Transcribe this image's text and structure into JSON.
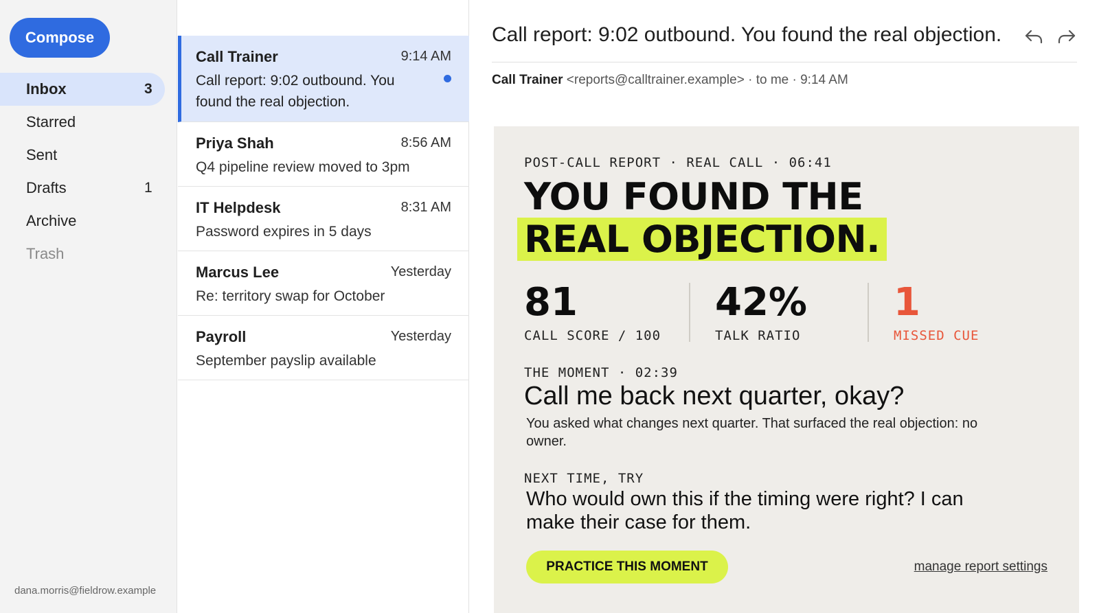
{
  "sidebar": {
    "compose_label": "Compose",
    "items": [
      {
        "label": "Inbox",
        "count": "3"
      },
      {
        "label": "Starred",
        "count": ""
      },
      {
        "label": "Sent",
        "count": ""
      },
      {
        "label": "Drafts",
        "count": "1"
      },
      {
        "label": "Archive",
        "count": ""
      },
      {
        "label": "Trash",
        "count": ""
      }
    ],
    "account": "dana.morris@fieldrow.example"
  },
  "messages": [
    {
      "sender": "Call Trainer",
      "time": "9:14 AM",
      "subject": "Call report: 9:02 outbound. You found the real objection.",
      "unread": true,
      "selected": true
    },
    {
      "sender": "Priya Shah",
      "time": "8:56 AM",
      "subject": "Q4 pipeline review moved to 3pm"
    },
    {
      "sender": "IT Helpdesk",
      "time": "8:31 AM",
      "subject": "Password expires in 5 days"
    },
    {
      "sender": "Marcus Lee",
      "time": "Yesterday",
      "subject": "Re: territory swap for October"
    },
    {
      "sender": "Payroll",
      "time": "Yesterday",
      "subject": "September payslip available"
    }
  ],
  "reader": {
    "subject": "Call report: 9:02 outbound. You found the real objection.",
    "from_name": "Call Trainer",
    "from_detail": "<reports@calltrainer.example> · to me · 9:14 AM",
    "icons": {
      "reply": "reply-icon",
      "forward": "forward-icon"
    }
  },
  "report": {
    "eyebrow": "POST-CALL REPORT · REAL CALL · 06:41",
    "headline_line1": "YOU FOUND THE",
    "headline_line2": "REAL OBJECTION.",
    "stats": [
      {
        "value": "81",
        "label": "CALL SCORE / 100"
      },
      {
        "value": "42%",
        "label": "TALK RATIO"
      },
      {
        "value": "1",
        "label": "MISSED CUE"
      }
    ],
    "moment_label": "THE MOMENT · 02:39",
    "moment_quote": "Call me back next quarter, okay?",
    "moment_body": "You asked what changes next quarter. That surfaced the real objection: no owner.",
    "next_label": "NEXT TIME, TRY",
    "next_body": "Who would own this if the timing were right? I can make their case for them.",
    "cta_label": "PRACTICE THIS MOMENT",
    "settings_link": "manage report settings"
  },
  "colors": {
    "accent": "#2f6be0",
    "highlight": "#dbf24a",
    "alert": "#e8563a",
    "card_bg": "#efede9"
  }
}
